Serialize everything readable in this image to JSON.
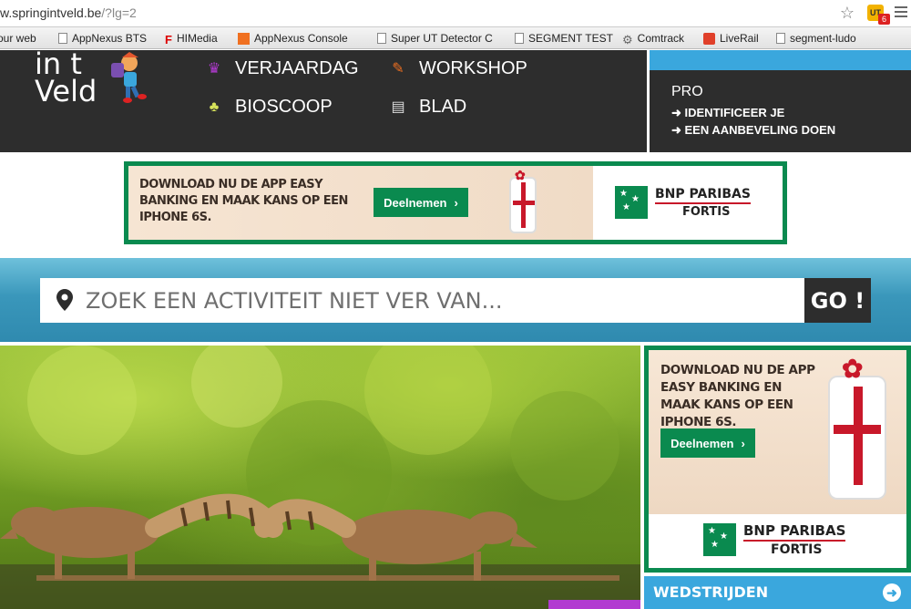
{
  "browser": {
    "url_host": "w.springintveld.be",
    "url_path": "/?lg=2",
    "extension_badge": "6",
    "extension_label": "UT",
    "bookmarks": [
      {
        "label": "our web",
        "icon": "none"
      },
      {
        "label": "AppNexus BTS",
        "icon": "page-icon"
      },
      {
        "label": "HIMedia",
        "icon": "himedia-icon"
      },
      {
        "label": "AppNexus Console",
        "icon": "appnexus-icon"
      },
      {
        "label": "Super UT Detector C",
        "icon": "page-icon"
      },
      {
        "label": "SEGMENT TEST",
        "icon": "page-icon"
      },
      {
        "label": "Comtrack",
        "icon": "gear-icon"
      },
      {
        "label": "LiveRail",
        "icon": "liverail-icon"
      },
      {
        "label": "segment-ludo",
        "icon": "page-icon"
      }
    ]
  },
  "header": {
    "logo_line1": "in t",
    "logo_line2": "Veld",
    "nav": [
      {
        "label": "VERJAARDAG",
        "icon": "cake-icon"
      },
      {
        "label": "WORKSHOP",
        "icon": "brush-icon"
      },
      {
        "label": "BIOSCOOP",
        "icon": "popcorn-icon"
      },
      {
        "label": "BLAD",
        "icon": "book-icon"
      }
    ],
    "pro": {
      "title": "PRO",
      "links": [
        "➜ IDENTIFICEER JE",
        "➜ EEN AANBEVELING DOEN"
      ]
    }
  },
  "banner_ad": {
    "text": "DOWNLOAD NU DE APP EASY BANKING EN MAAK KANS OP EEN IPHONE 6S.",
    "cta": "Deelnemen",
    "brand_line1": "BNP PARIBAS",
    "brand_line2": "FORTIS"
  },
  "search": {
    "placeholder": "ZOEK EEN ACTIVITEIT NIET VER VAN...",
    "go_label": "GO !"
  },
  "side_ad": {
    "text": "DOWNLOAD NU DE APP EASY BANKING EN MAAK KANS OP EEN IPHONE 6S.",
    "cta": "Deelnemen",
    "brand_line1": "BNP PARIBAS",
    "brand_line2": "FORTIS"
  },
  "wedstrijden": {
    "label": "WEDSTRIJDEN"
  },
  "colors": {
    "header_bg": "#2d2d2d",
    "accent_blue": "#3aa7dd",
    "bnp_green": "#0a8a4f",
    "bnp_red": "#c8182a"
  }
}
